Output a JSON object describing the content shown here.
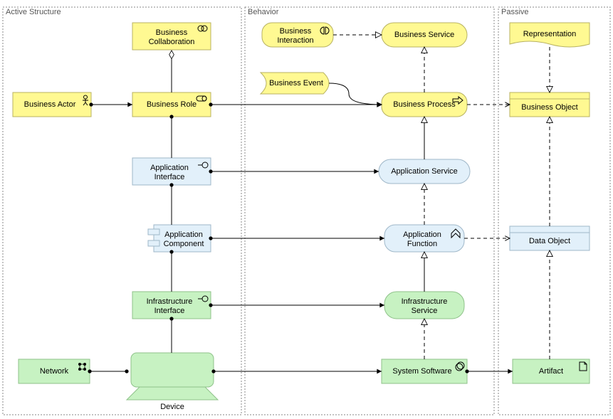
{
  "groups": {
    "active": "Active Structure",
    "behavior": "Behavior",
    "passive": "Passive"
  },
  "nodes": {
    "businessActor": "Business Actor",
    "businessRole": "Business Role",
    "businessCollab": "Business\nCollaboration",
    "businessInteraction": "Business\nInteraction",
    "businessService": "Business Service",
    "businessEvent": "Business Event",
    "businessProcess": "Business Process",
    "businessObject": "Business Object",
    "representation": "Representation",
    "appInterface": "Application\nInterface",
    "appService": "Application Service",
    "appComponent": "Application\nComponent",
    "appFunction": "Application\nFunction",
    "dataObject": "Data Object",
    "infraInterface": "Infrastructure\nInterface",
    "infraService": "Infrastructure\nService",
    "network": "Network",
    "device": "Device",
    "systemSoftware": "System Software",
    "artifact": "Artifact"
  },
  "colors": {
    "yellow": "#fff992",
    "yellowStroke": "#b8b262",
    "blue": "#e2f0fa",
    "blueStroke": "#9fb7c8",
    "green": "#c7f2c2",
    "greenStroke": "#8fc28a"
  }
}
